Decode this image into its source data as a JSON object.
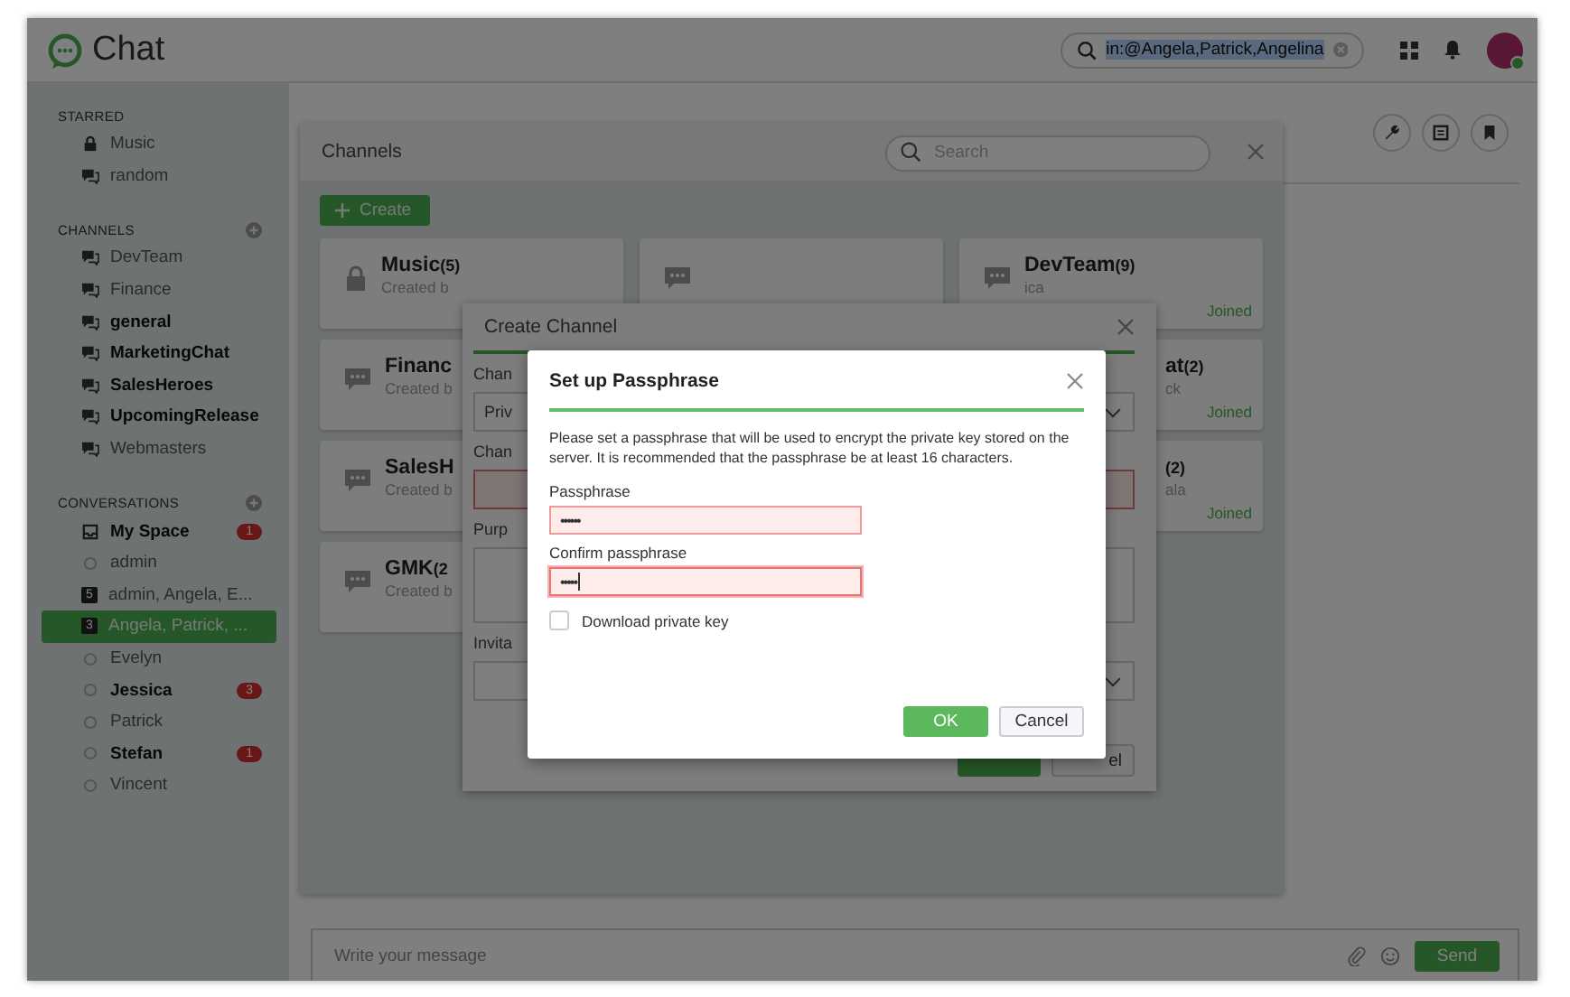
{
  "header": {
    "title": "Chat",
    "search": {
      "value": "in:@Angela,Patrick,Angelina",
      "highlighted": true
    }
  },
  "sidebar": [
    {
      "title": "STARRED",
      "add": false,
      "items": [
        {
          "label": "Music",
          "kind": "lock",
          "unread": false,
          "selected": false
        },
        {
          "label": "random",
          "kind": "chat",
          "unread": false,
          "selected": false
        }
      ]
    },
    {
      "title": "CHANNELS",
      "add": true,
      "items": [
        {
          "label": "DevTeam",
          "kind": "chat",
          "unread": false,
          "selected": false
        },
        {
          "label": "Finance",
          "kind": "chat",
          "unread": false,
          "selected": false
        },
        {
          "label": "general",
          "kind": "chat",
          "unread": true,
          "selected": false
        },
        {
          "label": "MarketingChat",
          "kind": "chat",
          "unread": true,
          "selected": false
        },
        {
          "label": "SalesHeroes",
          "kind": "chat",
          "unread": true,
          "selected": false
        },
        {
          "label": "UpcomingRelease",
          "kind": "chat",
          "unread": true,
          "selected": false
        },
        {
          "label": "Webmasters",
          "kind": "chat",
          "unread": false,
          "selected": false
        }
      ]
    },
    {
      "title": "CONVERSATIONS",
      "add": true,
      "items": [
        {
          "label": "My Space",
          "kind": "inbox",
          "unread": true,
          "selected": false,
          "badge": "1"
        },
        {
          "label": "admin",
          "kind": "person",
          "unread": false,
          "selected": false
        },
        {
          "label": "admin, Angela, E...",
          "kind": "group",
          "count": "5",
          "unread": false,
          "selected": false
        },
        {
          "label": "Angela, Patrick, ...",
          "kind": "group",
          "count": "3",
          "unread": false,
          "selected": true
        },
        {
          "label": "Evelyn",
          "kind": "person",
          "unread": false,
          "selected": false
        },
        {
          "label": "Jessica",
          "kind": "person",
          "unread": true,
          "selected": false,
          "badge": "3"
        },
        {
          "label": "Patrick",
          "kind": "person",
          "unread": false,
          "selected": false
        },
        {
          "label": "Stefan",
          "kind": "person",
          "unread": true,
          "selected": false,
          "badge": "1"
        },
        {
          "label": "Vincent",
          "kind": "person",
          "unread": false,
          "selected": false
        }
      ]
    }
  ],
  "chat": {
    "message": {
      "placeholder": "Write your message"
    },
    "send": "Send"
  },
  "channels_panel": {
    "title": "Channels",
    "search": {
      "placeholder": "Search"
    },
    "create": "Create",
    "columns": [
      [
        {
          "kind": "lock",
          "name": "Music",
          "count": "(5)",
          "creator": "Created b",
          "clipped": false
        },
        {
          "kind": "chat",
          "name": "Financ",
          "creator": "Created b",
          "clipped": false
        },
        {
          "kind": "chat",
          "name": "SalesH",
          "creator": "Created b",
          "clipped": false
        },
        {
          "kind": "chat",
          "name": "GMK",
          "count": "(2",
          "creator": "Created b",
          "clipped": false
        }
      ],
      [
        {
          "kind": "chat",
          "clipped": false
        }
      ],
      [
        {
          "kind": "chat",
          "name": "DevTeam",
          "count": "(9)",
          "creator": "ica",
          "status": "Joined",
          "clipped": false
        },
        {
          "kind": "chat",
          "name": "at",
          "count": "(2)",
          "creator": "ck",
          "status": "Joined",
          "clipped": true
        },
        {
          "kind": "chat",
          "count": "(2)",
          "creator": "ala",
          "status": "Joined",
          "clipped": true
        }
      ]
    ]
  },
  "create_dialog": {
    "title": "Create Channel",
    "rows": [
      {
        "kind": "label",
        "text": "Chan"
      },
      {
        "kind": "select",
        "text": "Priv"
      },
      {
        "kind": "label",
        "text": "Chan"
      },
      {
        "kind": "input",
        "invalid": true
      },
      {
        "kind": "label",
        "text": "Purp"
      },
      {
        "kind": "textarea"
      },
      {
        "kind": "label",
        "text": "Invita"
      },
      {
        "kind": "select"
      }
    ],
    "buttons": [
      {
        "kind": "primary"
      },
      {
        "kind": "secondary",
        "label": "el"
      }
    ]
  },
  "passphrase_dialog": {
    "title": "Set up Passphrase",
    "text": "Please set a passphrase that will be used to encrypt the private key stored on the server. It is recommended that the passphrase be at least 16 characters.",
    "fields": [
      {
        "label": "Passphrase",
        "value": "••••••",
        "invalid": true,
        "focused": false
      },
      {
        "label": "Confirm passphrase",
        "value": "•••••",
        "invalid": true,
        "focused": true
      }
    ],
    "download_private_key": {
      "label": "Download private key",
      "checked": false
    },
    "buttons": [
      {
        "kind": "primary",
        "label": "OK"
      },
      {
        "kind": "secondary",
        "label": "Cancel"
      }
    ]
  }
}
